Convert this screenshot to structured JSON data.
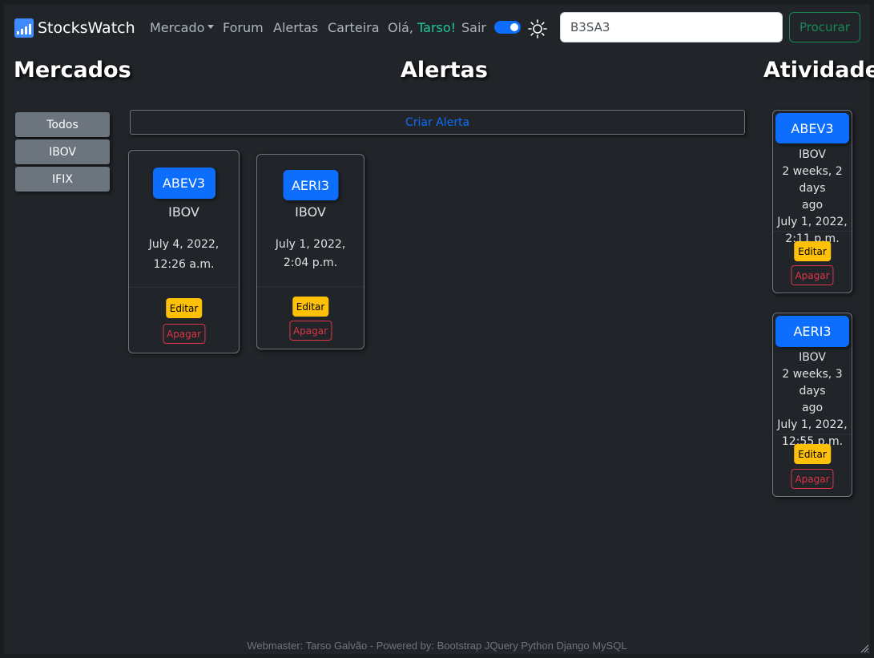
{
  "navbar": {
    "brand": "StocksWatch",
    "links": {
      "market": "Mercado",
      "forum": "Forum",
      "alerts": "Alertas",
      "wallet": "Carteira",
      "greeting": "Olá,",
      "user": "Tarso!",
      "logout": "Sair"
    },
    "search_value": "B3SA3",
    "search_button": "Procurar"
  },
  "headings": {
    "markets": "Mercados",
    "alerts": "Alertas",
    "activity": "Atividade"
  },
  "markets": [
    "Todos",
    "IBOV",
    "IFIX"
  ],
  "create_alert": "Criar Alerta",
  "alerts": [
    {
      "ticker": "ABEV3",
      "market": "IBOV",
      "date_line1": "July 4, 2022,",
      "date_line2": "12:26 a.m.",
      "edit": "Editar",
      "delete": "Apagar"
    },
    {
      "ticker": "AERI3",
      "market": "IBOV",
      "date_line1": "July 1, 2022,",
      "date_line2": "2:04 p.m.",
      "edit": "Editar",
      "delete": "Apagar"
    }
  ],
  "activity": [
    {
      "ticker": "ABEV3",
      "market": "IBOV",
      "ago_line1": "2 weeks, 2 days",
      "ago_line2": "ago",
      "date_line1": "July 1, 2022,",
      "date_line2": "2:11 p.m.",
      "edit": "Editar",
      "delete": "Apagar"
    },
    {
      "ticker": "AERI3",
      "market": "IBOV",
      "ago_line1": "2 weeks, 3 days",
      "ago_line2": "ago",
      "date_line1": "July 1, 2022,",
      "date_line2": "12:55 p.m.",
      "edit": "Editar",
      "delete": "Apagar"
    }
  ],
  "footer": "Webmaster: Tarso Galvão - Powered by: Bootstrap JQuery Python Django MySQL",
  "colors": {
    "background": "#212529",
    "primary": "#0d6efd",
    "warning": "#ffc107",
    "danger": "#dc3545",
    "success": "#198754",
    "teal": "#20c997"
  },
  "icons": {
    "brand": "signal-bars-icon",
    "theme": "sun-icon",
    "resize": "resize-grip-icon"
  }
}
